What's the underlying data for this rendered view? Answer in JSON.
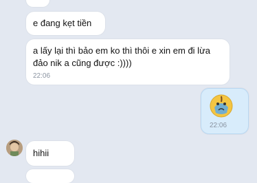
{
  "messages": [
    {
      "side": "incoming",
      "text": "e đang kẹt tiền"
    },
    {
      "side": "incoming",
      "line1": "a lấy lại thì bảo em ko thì thôi e xin em đi lừa",
      "line2": "đảo nik a cũng được :))))",
      "time": "22:06"
    },
    {
      "side": "outgoing",
      "sticker": "crying-face-sticker",
      "time": "22:06"
    },
    {
      "side": "incoming",
      "text": "hihii"
    }
  ],
  "colors": {
    "background": "#e3e8f1",
    "incoming_bubble": "#ffffff",
    "outgoing_bubble": "#d8ecfb",
    "time_text": "#8a93a0"
  }
}
